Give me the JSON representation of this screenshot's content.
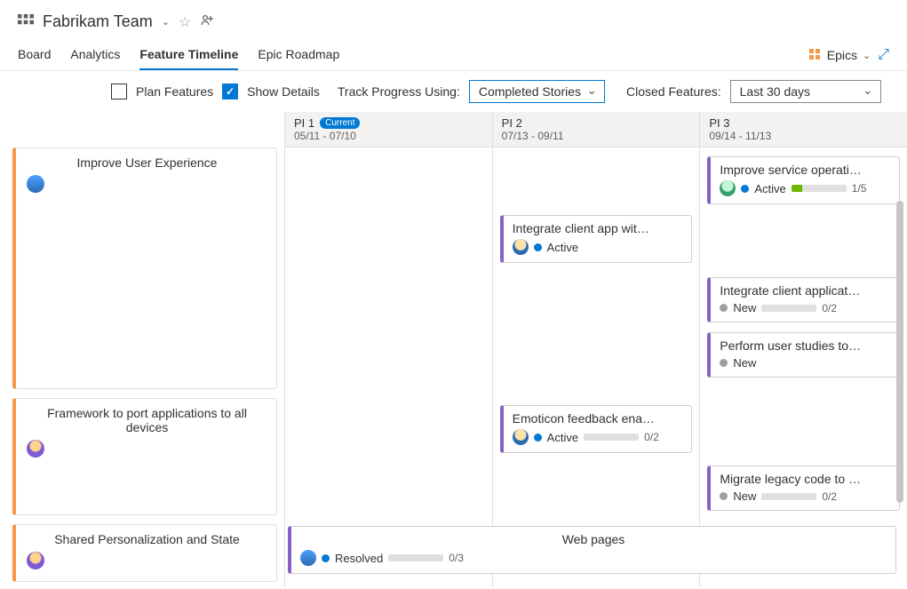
{
  "header": {
    "team_name": "Fabrikam Team"
  },
  "tabs": {
    "board": "Board",
    "analytics": "Analytics",
    "feature_timeline": "Feature Timeline",
    "epic_roadmap": "Epic Roadmap"
  },
  "right_tools": {
    "epics": "Epics"
  },
  "controls": {
    "plan_features": "Plan Features",
    "show_details": "Show Details",
    "track_label": "Track Progress Using:",
    "track_value": "Completed Stories",
    "closed_label": "Closed Features:",
    "closed_value": "Last 30 days"
  },
  "columns": [
    {
      "name": "PI 1",
      "current": "Current",
      "dates": "05/11 - 07/10"
    },
    {
      "name": "PI 2",
      "current": "",
      "dates": "07/13 - 09/11"
    },
    {
      "name": "PI 3",
      "current": "",
      "dates": "09/14 - 11/13"
    }
  ],
  "epics": [
    {
      "title": "Improve User Experience"
    },
    {
      "title": "Framework to port applications to all devices"
    },
    {
      "title": "Shared Personalization and State"
    }
  ],
  "features": {
    "r1_c2": {
      "title": "Integrate client app wit…",
      "state": "Active"
    },
    "r1_c3_a": {
      "title": "Improve service operati…",
      "state": "Active",
      "progress_text": "1/5",
      "progress_pct": 20
    },
    "r1_c3_b": {
      "title": "Integrate client applicat…",
      "state": "New",
      "progress_text": "0/2",
      "progress_pct": 0
    },
    "r1_c3_c": {
      "title": "Perform user studies to…",
      "state": "New"
    },
    "r2_c2": {
      "title": "Emoticon feedback ena…",
      "state": "Active",
      "progress_text": "0/2",
      "progress_pct": 0
    },
    "r2_c3": {
      "title": "Migrate legacy code to …",
      "state": "New",
      "progress_text": "0/2",
      "progress_pct": 0
    },
    "r3_wide": {
      "title": "Web pages",
      "state": "Resolved",
      "progress_text": "0/3",
      "progress_pct": 0
    }
  }
}
